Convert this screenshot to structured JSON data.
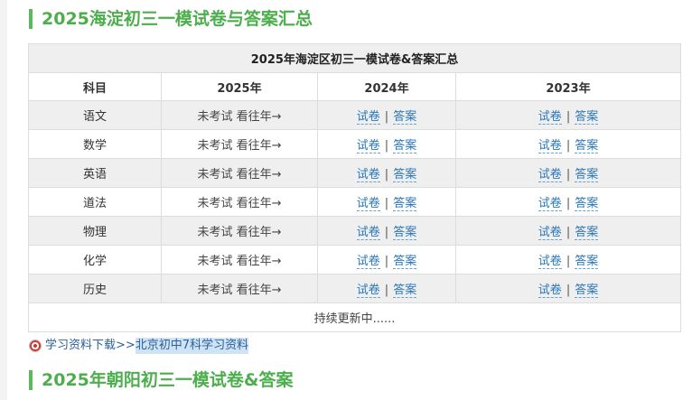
{
  "section1_title": "2025海淀初三一模试卷与答案汇总",
  "table": {
    "caption": "2025年海淀区初三一模试卷&答案汇总",
    "headers": [
      "科目",
      "2025年",
      "2024年",
      "2023年"
    ],
    "na_text": "未考试 看往年→",
    "exam_label": "试卷",
    "sep": "|",
    "answer_label": "答案",
    "rows": [
      {
        "subject": "语文"
      },
      {
        "subject": "数学"
      },
      {
        "subject": "英语"
      },
      {
        "subject": "道法"
      },
      {
        "subject": "物理"
      },
      {
        "subject": "化学"
      },
      {
        "subject": "历史"
      }
    ],
    "footer": "持续更新中......"
  },
  "download": {
    "prefix": "学习资料下载>>",
    "link": "北京初中7科学习资料"
  },
  "section2_title": "2025年朝阳初三一模试卷&答案"
}
